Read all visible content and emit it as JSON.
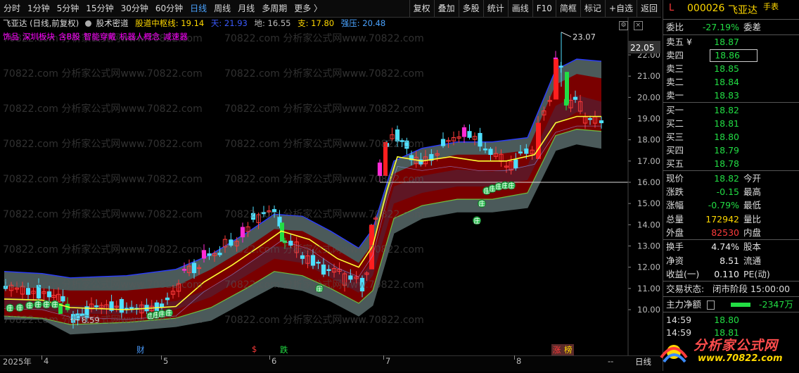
{
  "toolbar": {
    "periods": [
      "分时",
      "1分钟",
      "5分钟",
      "15分钟",
      "30分钟",
      "60分钟",
      "日线",
      "周线",
      "月线",
      "多周期",
      "更多 〉"
    ],
    "active_period": "日线",
    "right_items": [
      "复权",
      "叠加",
      "多股",
      "统计",
      "画线",
      "F10",
      "简框",
      "标记",
      "+自选",
      "返回"
    ]
  },
  "info": {
    "stock_line": "飞亚达 (日线,前复权)",
    "indicator_name": "股术密道",
    "center_label": "股道中枢线:",
    "center_value": "19.14",
    "sky_label": "天:",
    "sky_value": "21.93",
    "ground_label": "地:",
    "ground_value": "16.55",
    "support_label": "支:",
    "support_value": "17.80",
    "pressure_label": "强压:",
    "pressure_value": "20.48",
    "concepts": [
      "饰品",
      "深圳板块",
      "含B股",
      "智能穿戴",
      "机器人概念",
      "减速器"
    ]
  },
  "chart_data": {
    "type": "candlestick",
    "y_ticks": [
      "22.00",
      "21.00",
      "20.00",
      "19.00",
      "18.00",
      "17.00",
      "16.00",
      "15.00",
      "14.00",
      "13.00",
      "12.00",
      "11.00",
      "10.00"
    ],
    "ylim": [
      9.55,
      23.6
    ],
    "current_price_label": "22.05",
    "high_marker": "23.07",
    "low_marker": "8.59",
    "x_labels": [
      "2025年",
      "4",
      "5",
      "6",
      "7",
      "8"
    ],
    "events": [
      {
        "text": "财",
        "color": "#4a9cff"
      },
      {
        "text": "$",
        "color": "#ff3b3b"
      },
      {
        "text": "跌",
        "color": "#22dd44"
      },
      {
        "text": "涨",
        "color": "#ff3b3b"
      },
      {
        "text": "榜",
        "color": "#ffd800"
      }
    ],
    "zoom_label": "--",
    "period_label": "日线",
    "signal_text": "庄",
    "watermark": "70822.com 分析家公式网www.70822.com"
  },
  "panel": {
    "code": "000026",
    "name": "飞亚达",
    "badge": "L",
    "handbook": "手表",
    "commission_ratio_label": "委比",
    "commission_ratio": "-27.19%",
    "commission_diff_label": "委差",
    "asks": [
      {
        "label": "卖五 ¥",
        "price": "18.87"
      },
      {
        "label": "卖四",
        "price": "18.86"
      },
      {
        "label": "卖三",
        "price": "18.85"
      },
      {
        "label": "卖二",
        "price": "18.84"
      },
      {
        "label": "卖一",
        "price": "18.83"
      }
    ],
    "bids": [
      {
        "label": "买一",
        "price": "18.82"
      },
      {
        "label": "买二",
        "price": "18.81"
      },
      {
        "label": "买三",
        "price": "18.80"
      },
      {
        "label": "买四",
        "price": "18.79"
      },
      {
        "label": "买五",
        "price": "18.78"
      }
    ],
    "quote": [
      {
        "label": "现价",
        "value": "18.82",
        "label2": "今开",
        "color": "green"
      },
      {
        "label": "涨跌",
        "value": "-0.15",
        "label2": "最高",
        "color": "green"
      },
      {
        "label": "涨幅",
        "value": "-0.79%",
        "label2": "最低",
        "color": "green"
      },
      {
        "label": "总量",
        "value": "172942",
        "label2": "量比",
        "color": "yellow"
      },
      {
        "label": "外盘",
        "value": "82530",
        "label2": "内盘",
        "color": "red"
      }
    ],
    "stats": [
      {
        "label": "换手",
        "value": "4.74%",
        "label2": "股本"
      },
      {
        "label": "净资",
        "value": "8.51",
        "label2": "流通"
      },
      {
        "label": "收益(一)",
        "value": "0.110",
        "label2": "PE(动)"
      }
    ],
    "status_label": "交易状态:",
    "status_value": "闭市阶段 15:00:00",
    "main_flow_label": "主力净额",
    "main_flow_value": "-2347万",
    "ticks": [
      {
        "time": "14:59",
        "price": "18.80"
      },
      {
        "time": "14:59",
        "price": "18.81"
      }
    ]
  },
  "logo": {
    "text": "分析家公式网",
    "url": "www.70822.com"
  }
}
